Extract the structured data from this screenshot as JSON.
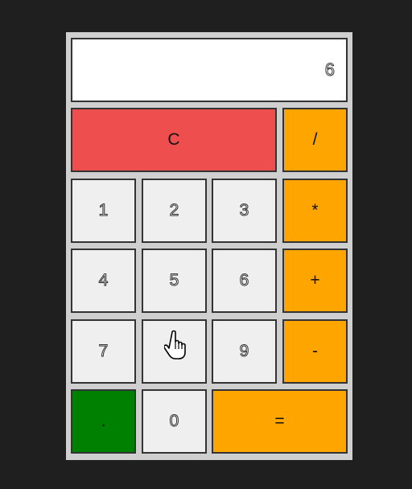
{
  "display": {
    "value": "6"
  },
  "buttons": {
    "clear": "C",
    "divide": "/",
    "one": "1",
    "two": "2",
    "three": "3",
    "multiply": "*",
    "four": "4",
    "five": "5",
    "six": "6",
    "plus": "+",
    "seven": "7",
    "eight": "8",
    "nine": "9",
    "minus": "-",
    "dot": ".",
    "zero": "0",
    "equals": "="
  },
  "colors": {
    "clear": "#ef4e4e",
    "operator": "#ffa500",
    "dot": "#008000",
    "number": "#efefef"
  },
  "icons": {
    "cursor": "hand-pointer-icon"
  }
}
